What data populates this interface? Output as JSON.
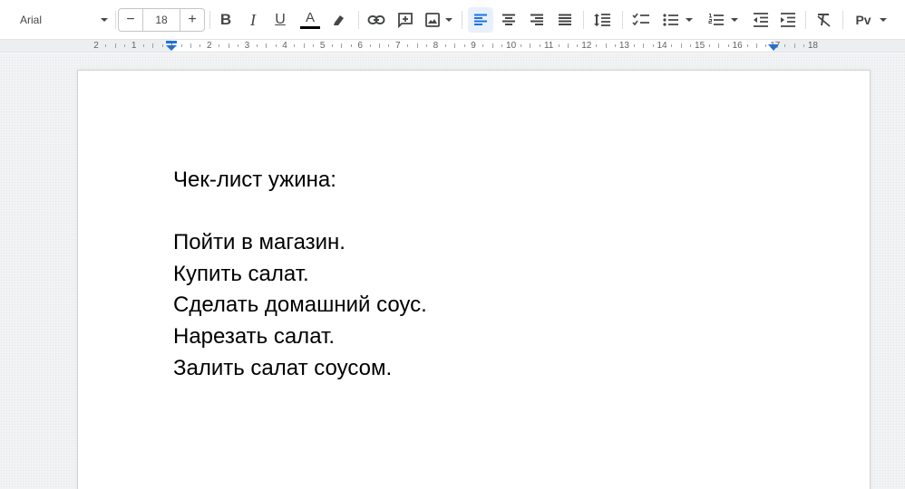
{
  "toolbar": {
    "font_family": "Arial",
    "font_size": "18",
    "decrease_glyph": "−",
    "increase_glyph": "+",
    "bold_glyph": "B",
    "italic_glyph": "I",
    "underline_glyph": "U",
    "text_color_glyph": "A",
    "text_color": "#000000",
    "input_tools_label": "Рv",
    "icons": [
      "chevron-down-icon",
      "bold-icon",
      "italic-icon",
      "underline-icon",
      "text-color-icon",
      "highlighter-icon",
      "link-icon",
      "add-comment-icon",
      "insert-image-icon",
      "align-left-icon",
      "align-center-icon",
      "align-right-icon",
      "justify-icon",
      "line-spacing-icon",
      "checklist-icon",
      "bulleted-list-icon",
      "numbered-list-icon",
      "decrease-indent-icon",
      "increase-indent-icon",
      "clear-formatting-icon",
      "input-tools-icon"
    ],
    "active_alignment": "left"
  },
  "ruler": {
    "labels": [
      "2",
      "1",
      "1",
      "2",
      "3",
      "4",
      "5",
      "6",
      "7",
      "8",
      "9",
      "10",
      "11",
      "12",
      "13",
      "14",
      "15",
      "16",
      "17",
      "18"
    ]
  },
  "document": {
    "lines": [
      "Чек-лист ужина:",
      "",
      "Пойти в магазин.",
      "Купить салат.",
      "Сделать домашний соус.",
      "Нарезать салат.",
      "Залить салат соусом."
    ]
  },
  "colors": {
    "accent": "#1a73e8",
    "toolbar_bg": "#ffffff",
    "page_bg": "#ffffff",
    "canvas_bg": "#f1f3f4"
  }
}
